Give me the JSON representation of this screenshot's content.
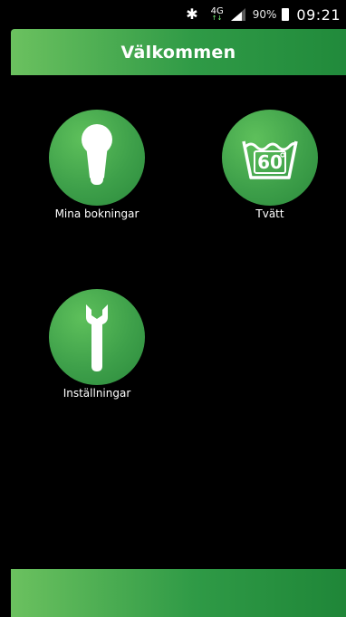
{
  "status_bar": {
    "bluetooth_icon": "bluetooth-icon",
    "network_label": "4G",
    "network_sub": "↑↓",
    "signal_icon": "signal-icon",
    "battery_percent": "90%",
    "battery_icon": "battery-icon",
    "time": "09:21"
  },
  "header": {
    "title": "Välkommen"
  },
  "tiles": [
    {
      "label": "Mina bokningar",
      "icon": "key-lock-icon"
    },
    {
      "label": "Tvätt",
      "icon": "washing-60-icon",
      "icon_text": "60"
    },
    {
      "label": "Inställningar",
      "icon": "wrench-icon"
    }
  ],
  "colors": {
    "accent_green": "#3ea04a",
    "header_gradient_start": "#6bc15f",
    "header_gradient_end": "#218a3b",
    "background": "#000000"
  }
}
